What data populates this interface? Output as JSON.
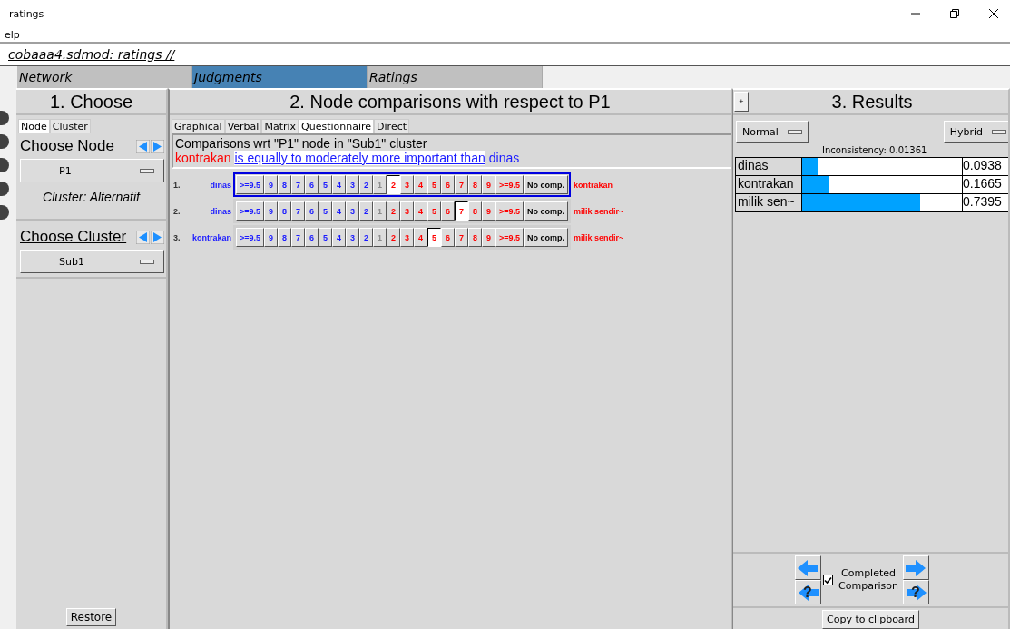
{
  "window": {
    "title": "ratings"
  },
  "menu": [
    "elp"
  ],
  "file_path": "cobaaa4.sdmod: ratings //",
  "main_tabs": [
    {
      "label": "Network",
      "selected": false
    },
    {
      "label": "Judgments",
      "selected": true
    },
    {
      "label": "Ratings",
      "selected": false
    }
  ],
  "choose": {
    "title": "1. Choose",
    "tabs": [
      {
        "label": "Node",
        "selected": true
      },
      {
        "label": "Cluster",
        "selected": false
      }
    ],
    "node_heading": "Choose Node",
    "node_value": "P1",
    "cluster_info": "Cluster: Alternatif",
    "cluster_heading": "Choose Cluster",
    "cluster_value": "Sub1",
    "restore": "Restore"
  },
  "comparisons": {
    "title": "2. Node comparisons with respect to P1",
    "tabs": [
      {
        "label": "Graphical",
        "selected": false
      },
      {
        "label": "Verbal",
        "selected": false
      },
      {
        "label": "Matrix",
        "selected": false
      },
      {
        "label": "Questionnaire",
        "selected": true
      },
      {
        "label": "Direct",
        "selected": false
      }
    ],
    "heading": "Comparisons wrt \"P1\" node in \"Sub1\" cluster",
    "verdict": {
      "subject": "kontrakan",
      "phrase": "is equally to moderately more important than",
      "object": "dinas"
    },
    "rows": [
      {
        "number": "1.",
        "left": "dinas",
        "right": "kontrakan",
        "current": true,
        "cells": [
          {
            "label": ">=9.5",
            "kind": "left",
            "selected": false
          },
          {
            "label": "9",
            "kind": "left",
            "selected": false
          },
          {
            "label": "8",
            "kind": "left",
            "selected": false
          },
          {
            "label": "7",
            "kind": "left",
            "selected": false
          },
          {
            "label": "6",
            "kind": "left",
            "selected": false
          },
          {
            "label": "5",
            "kind": "left",
            "selected": false
          },
          {
            "label": "4",
            "kind": "left",
            "selected": false
          },
          {
            "label": "3",
            "kind": "left",
            "selected": false
          },
          {
            "label": "2",
            "kind": "left",
            "selected": false
          },
          {
            "label": "1",
            "kind": "center",
            "selected": false
          },
          {
            "label": "2",
            "kind": "right",
            "selected": true
          },
          {
            "label": "3",
            "kind": "right",
            "selected": false
          },
          {
            "label": "4",
            "kind": "right",
            "selected": false
          },
          {
            "label": "5",
            "kind": "right",
            "selected": false
          },
          {
            "label": "6",
            "kind": "right",
            "selected": false
          },
          {
            "label": "7",
            "kind": "right",
            "selected": false
          },
          {
            "label": "8",
            "kind": "right",
            "selected": false
          },
          {
            "label": "9",
            "kind": "right",
            "selected": false
          },
          {
            "label": ">=9.5",
            "kind": "right",
            "selected": false
          },
          {
            "label": "No comp.",
            "kind": "none",
            "selected": false
          }
        ]
      },
      {
        "number": "2.",
        "left": "dinas",
        "right": "milik sendir~",
        "current": false,
        "cells": [
          {
            "label": ">=9.5",
            "kind": "left",
            "selected": false
          },
          {
            "label": "9",
            "kind": "left",
            "selected": false
          },
          {
            "label": "8",
            "kind": "left",
            "selected": false
          },
          {
            "label": "7",
            "kind": "left",
            "selected": false
          },
          {
            "label": "6",
            "kind": "left",
            "selected": false
          },
          {
            "label": "5",
            "kind": "left",
            "selected": false
          },
          {
            "label": "4",
            "kind": "left",
            "selected": false
          },
          {
            "label": "3",
            "kind": "left",
            "selected": false
          },
          {
            "label": "2",
            "kind": "left",
            "selected": false
          },
          {
            "label": "1",
            "kind": "center",
            "selected": false
          },
          {
            "label": "2",
            "kind": "right",
            "selected": false
          },
          {
            "label": "3",
            "kind": "right",
            "selected": false
          },
          {
            "label": "4",
            "kind": "right",
            "selected": false
          },
          {
            "label": "5",
            "kind": "right",
            "selected": false
          },
          {
            "label": "6",
            "kind": "right",
            "selected": false
          },
          {
            "label": "7",
            "kind": "right",
            "selected": true
          },
          {
            "label": "8",
            "kind": "right",
            "selected": false
          },
          {
            "label": "9",
            "kind": "right",
            "selected": false
          },
          {
            "label": ">=9.5",
            "kind": "right",
            "selected": false
          },
          {
            "label": "No comp.",
            "kind": "none",
            "selected": false
          }
        ]
      },
      {
        "number": "3.",
        "left": "kontrakan",
        "right": "milik sendir~",
        "current": false,
        "cells": [
          {
            "label": ">=9.5",
            "kind": "left",
            "selected": false
          },
          {
            "label": "9",
            "kind": "left",
            "selected": false
          },
          {
            "label": "8",
            "kind": "left",
            "selected": false
          },
          {
            "label": "7",
            "kind": "left",
            "selected": false
          },
          {
            "label": "6",
            "kind": "left",
            "selected": false
          },
          {
            "label": "5",
            "kind": "left",
            "selected": false
          },
          {
            "label": "4",
            "kind": "left",
            "selected": false
          },
          {
            "label": "3",
            "kind": "left",
            "selected": false
          },
          {
            "label": "2",
            "kind": "left",
            "selected": false
          },
          {
            "label": "1",
            "kind": "center",
            "selected": false
          },
          {
            "label": "2",
            "kind": "right",
            "selected": false
          },
          {
            "label": "3",
            "kind": "right",
            "selected": false
          },
          {
            "label": "4",
            "kind": "right",
            "selected": false
          },
          {
            "label": "5",
            "kind": "right",
            "selected": true
          },
          {
            "label": "6",
            "kind": "right",
            "selected": false
          },
          {
            "label": "7",
            "kind": "right",
            "selected": false
          },
          {
            "label": "8",
            "kind": "right",
            "selected": false
          },
          {
            "label": "9",
            "kind": "right",
            "selected": false
          },
          {
            "label": ">=9.5",
            "kind": "right",
            "selected": false
          },
          {
            "label": "No comp.",
            "kind": "none",
            "selected": false
          }
        ]
      }
    ]
  },
  "results": {
    "expand": "+",
    "title": "3. Results",
    "mode_left": "Normal",
    "mode_right": "Hybrid",
    "inconsistency": "Inconsistency: 0.01361",
    "rows": [
      {
        "name": "dinas",
        "level": 0.094,
        "value": "0.0938"
      },
      {
        "name": "kontrakan",
        "level": 0.167,
        "value": "0.1665"
      },
      {
        "name": "milik sen~",
        "level": 0.74,
        "value": "0.7395"
      }
    ],
    "help": "?",
    "completed": {
      "label": "Completed Comparison",
      "checked": true
    },
    "copy": "Copy to clipboard"
  }
}
